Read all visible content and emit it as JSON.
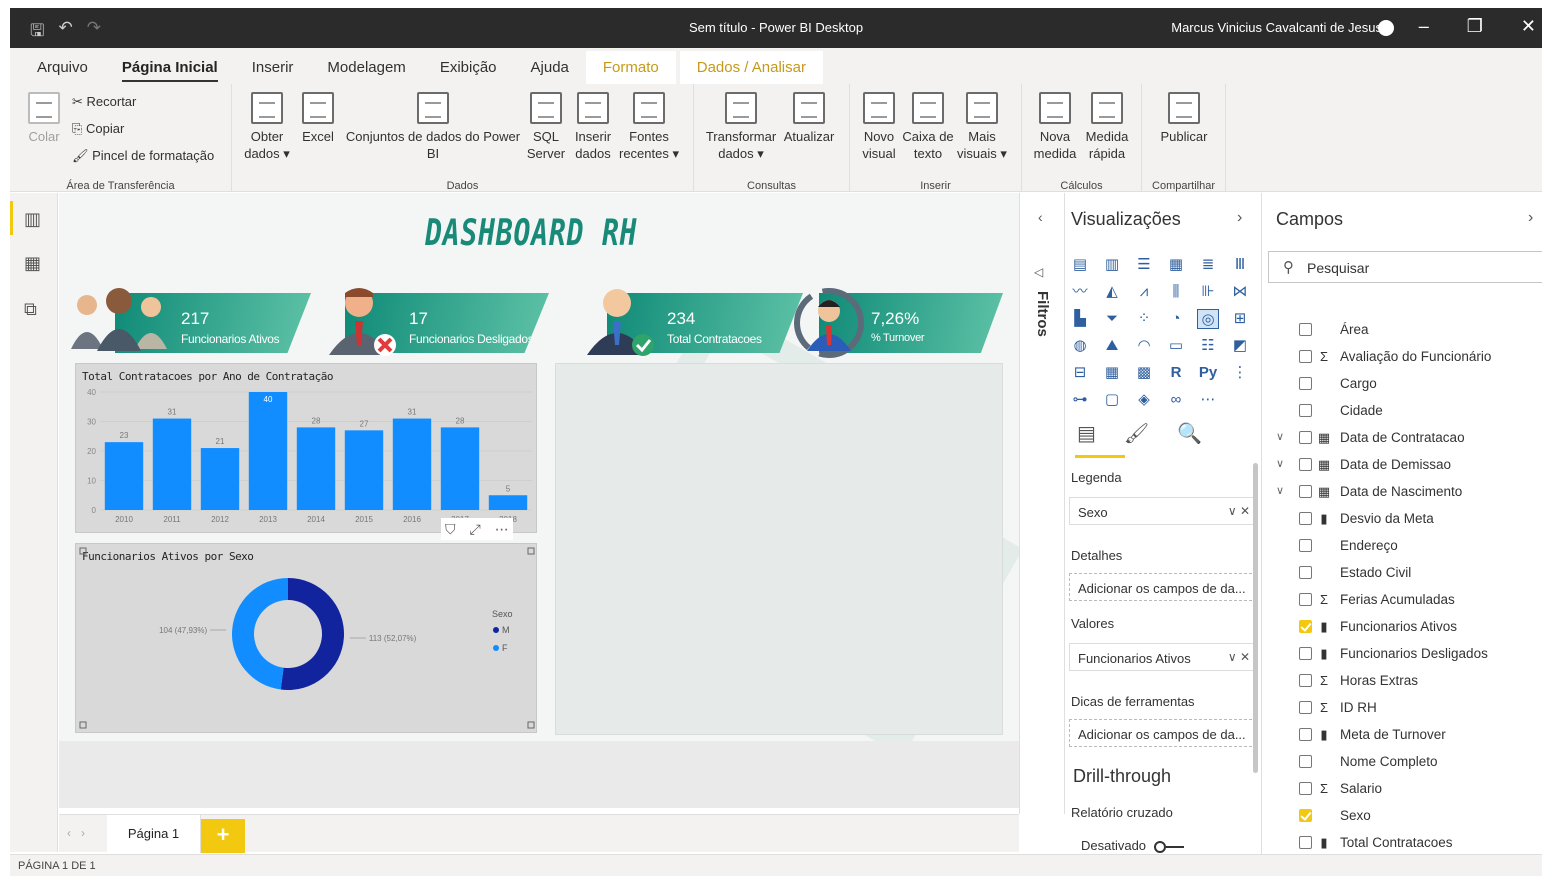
{
  "window": {
    "title": "Sem título - Power BI Desktop",
    "user": "Marcus Vinicius Cavalcanti de Jesus"
  },
  "ribbon_tabs": [
    "Arquivo",
    "Página Inicial",
    "Inserir",
    "Modelagem",
    "Exibição",
    "Ajuda",
    "Formato",
    "Dados / Analisar"
  ],
  "ribbon": {
    "clipboard": {
      "paste": "Colar",
      "cut": "Recortar",
      "copy": "Copiar",
      "format_painter": "Pincel de formatação",
      "group": "Área de Transferência"
    },
    "data": {
      "get_data_1": "Obter",
      "get_data_2": "dados",
      "excel": "Excel",
      "datasets_1": "Conjuntos de dados do Power",
      "datasets_2": "BI",
      "sql_1": "SQL",
      "sql_2": "Server",
      "enter_1": "Inserir",
      "enter_2": "dados",
      "recent_1": "Fontes",
      "recent_2": "recentes",
      "group": "Dados"
    },
    "queries": {
      "transform_1": "Transformar",
      "transform_2": "dados",
      "refresh": "Atualizar",
      "group": "Consultas"
    },
    "insert": {
      "new_visual_1": "Novo",
      "new_visual_2": "visual",
      "textbox_1": "Caixa de",
      "textbox_2": "texto",
      "more_1": "Mais",
      "more_2": "visuais",
      "group": "Inserir"
    },
    "calc": {
      "new_measure_1": "Nova",
      "new_measure_2": "medida",
      "quick_1": "Medida",
      "quick_2": "rápida",
      "group": "Cálculos"
    },
    "share": {
      "publish": "Publicar",
      "group": "Compartilhar"
    }
  },
  "dashboard": {
    "title": "DASHBOARD RH",
    "kpis": [
      {
        "value": "217",
        "label": "Funcionarios Ativos"
      },
      {
        "value": "17",
        "label": "Funcionarios Desligados"
      },
      {
        "value": "234",
        "label": "Total Contratacoes"
      },
      {
        "value": "7,26%",
        "label": "% Turnover"
      }
    ]
  },
  "chart_data": [
    {
      "type": "bar",
      "title": "Total Contratacoes por Ano de Contratação",
      "categories": [
        "2010",
        "2011",
        "2012",
        "2013",
        "2014",
        "2015",
        "2016",
        "2017",
        "2018"
      ],
      "values": [
        23,
        31,
        21,
        40,
        28,
        27,
        31,
        28,
        5
      ],
      "ylim": [
        0,
        40
      ],
      "yticks": [
        0,
        10,
        20,
        30,
        40
      ],
      "color": "#118dff"
    },
    {
      "type": "pie",
      "title": "Funcionarios Ativos por Sexo",
      "legend_title": "Sexo",
      "slices": [
        {
          "label": "M",
          "value": 113,
          "display": "113 (52,07%)",
          "color": "#12239e"
        },
        {
          "label": "F",
          "value": 104,
          "display": "104 (47,93%)",
          "color": "#118dff"
        }
      ]
    }
  ],
  "page_tab": "Página 1",
  "status": "PÁGINA 1 DE 1",
  "filters_label": "Filtros",
  "viz": {
    "title": "Visualizações",
    "legend_label": "Legenda",
    "legend_value": "Sexo",
    "details_label": "Detalhes",
    "details_placeholder": "Adicionar os campos de da...",
    "values_label": "Valores",
    "values_value": "Funcionarios Ativos",
    "tooltips_label": "Dicas de ferramentas",
    "tooltips_placeholder": "Adicionar os campos de da...",
    "drill": "Drill-through",
    "cross_report": "Relatório cruzado",
    "toggle": "Desativado",
    "r_label": "R",
    "py_label": "Py"
  },
  "fields": {
    "title": "Campos",
    "search_placeholder": "Pesquisar",
    "items": [
      {
        "name": "Área",
        "type": "",
        "checked": false,
        "expand": false
      },
      {
        "name": "Avaliação do Funcionário",
        "type": "Σ",
        "checked": false,
        "expand": false
      },
      {
        "name": "Cargo",
        "type": "",
        "checked": false,
        "expand": false
      },
      {
        "name": "Cidade",
        "type": "",
        "checked": false,
        "expand": false
      },
      {
        "name": "Data de Contratacao",
        "type": "▦",
        "checked": false,
        "expand": true
      },
      {
        "name": "Data de Demissao",
        "type": "▦",
        "checked": false,
        "expand": true
      },
      {
        "name": "Data de Nascimento",
        "type": "▦",
        "checked": false,
        "expand": true
      },
      {
        "name": "Desvio da Meta",
        "type": "▮",
        "checked": false,
        "expand": false
      },
      {
        "name": "Endereço",
        "type": "",
        "checked": false,
        "expand": false
      },
      {
        "name": "Estado Civil",
        "type": "",
        "checked": false,
        "expand": false
      },
      {
        "name": "Ferias Acumuladas",
        "type": "Σ",
        "checked": false,
        "expand": false
      },
      {
        "name": "Funcionarios Ativos",
        "type": "▮",
        "checked": true,
        "expand": false
      },
      {
        "name": "Funcionarios Desligados",
        "type": "▮",
        "checked": false,
        "expand": false
      },
      {
        "name": "Horas Extras",
        "type": "Σ",
        "checked": false,
        "expand": false
      },
      {
        "name": "ID RH",
        "type": "Σ",
        "checked": false,
        "expand": false
      },
      {
        "name": "Meta de Turnover",
        "type": "▮",
        "checked": false,
        "expand": false
      },
      {
        "name": "Nome Completo",
        "type": "",
        "checked": false,
        "expand": false
      },
      {
        "name": "Salario",
        "type": "Σ",
        "checked": false,
        "expand": false
      },
      {
        "name": "Sexo",
        "type": "",
        "checked": true,
        "expand": false
      },
      {
        "name": "Total Contratacoes",
        "type": "▮",
        "checked": false,
        "expand": false
      }
    ]
  }
}
